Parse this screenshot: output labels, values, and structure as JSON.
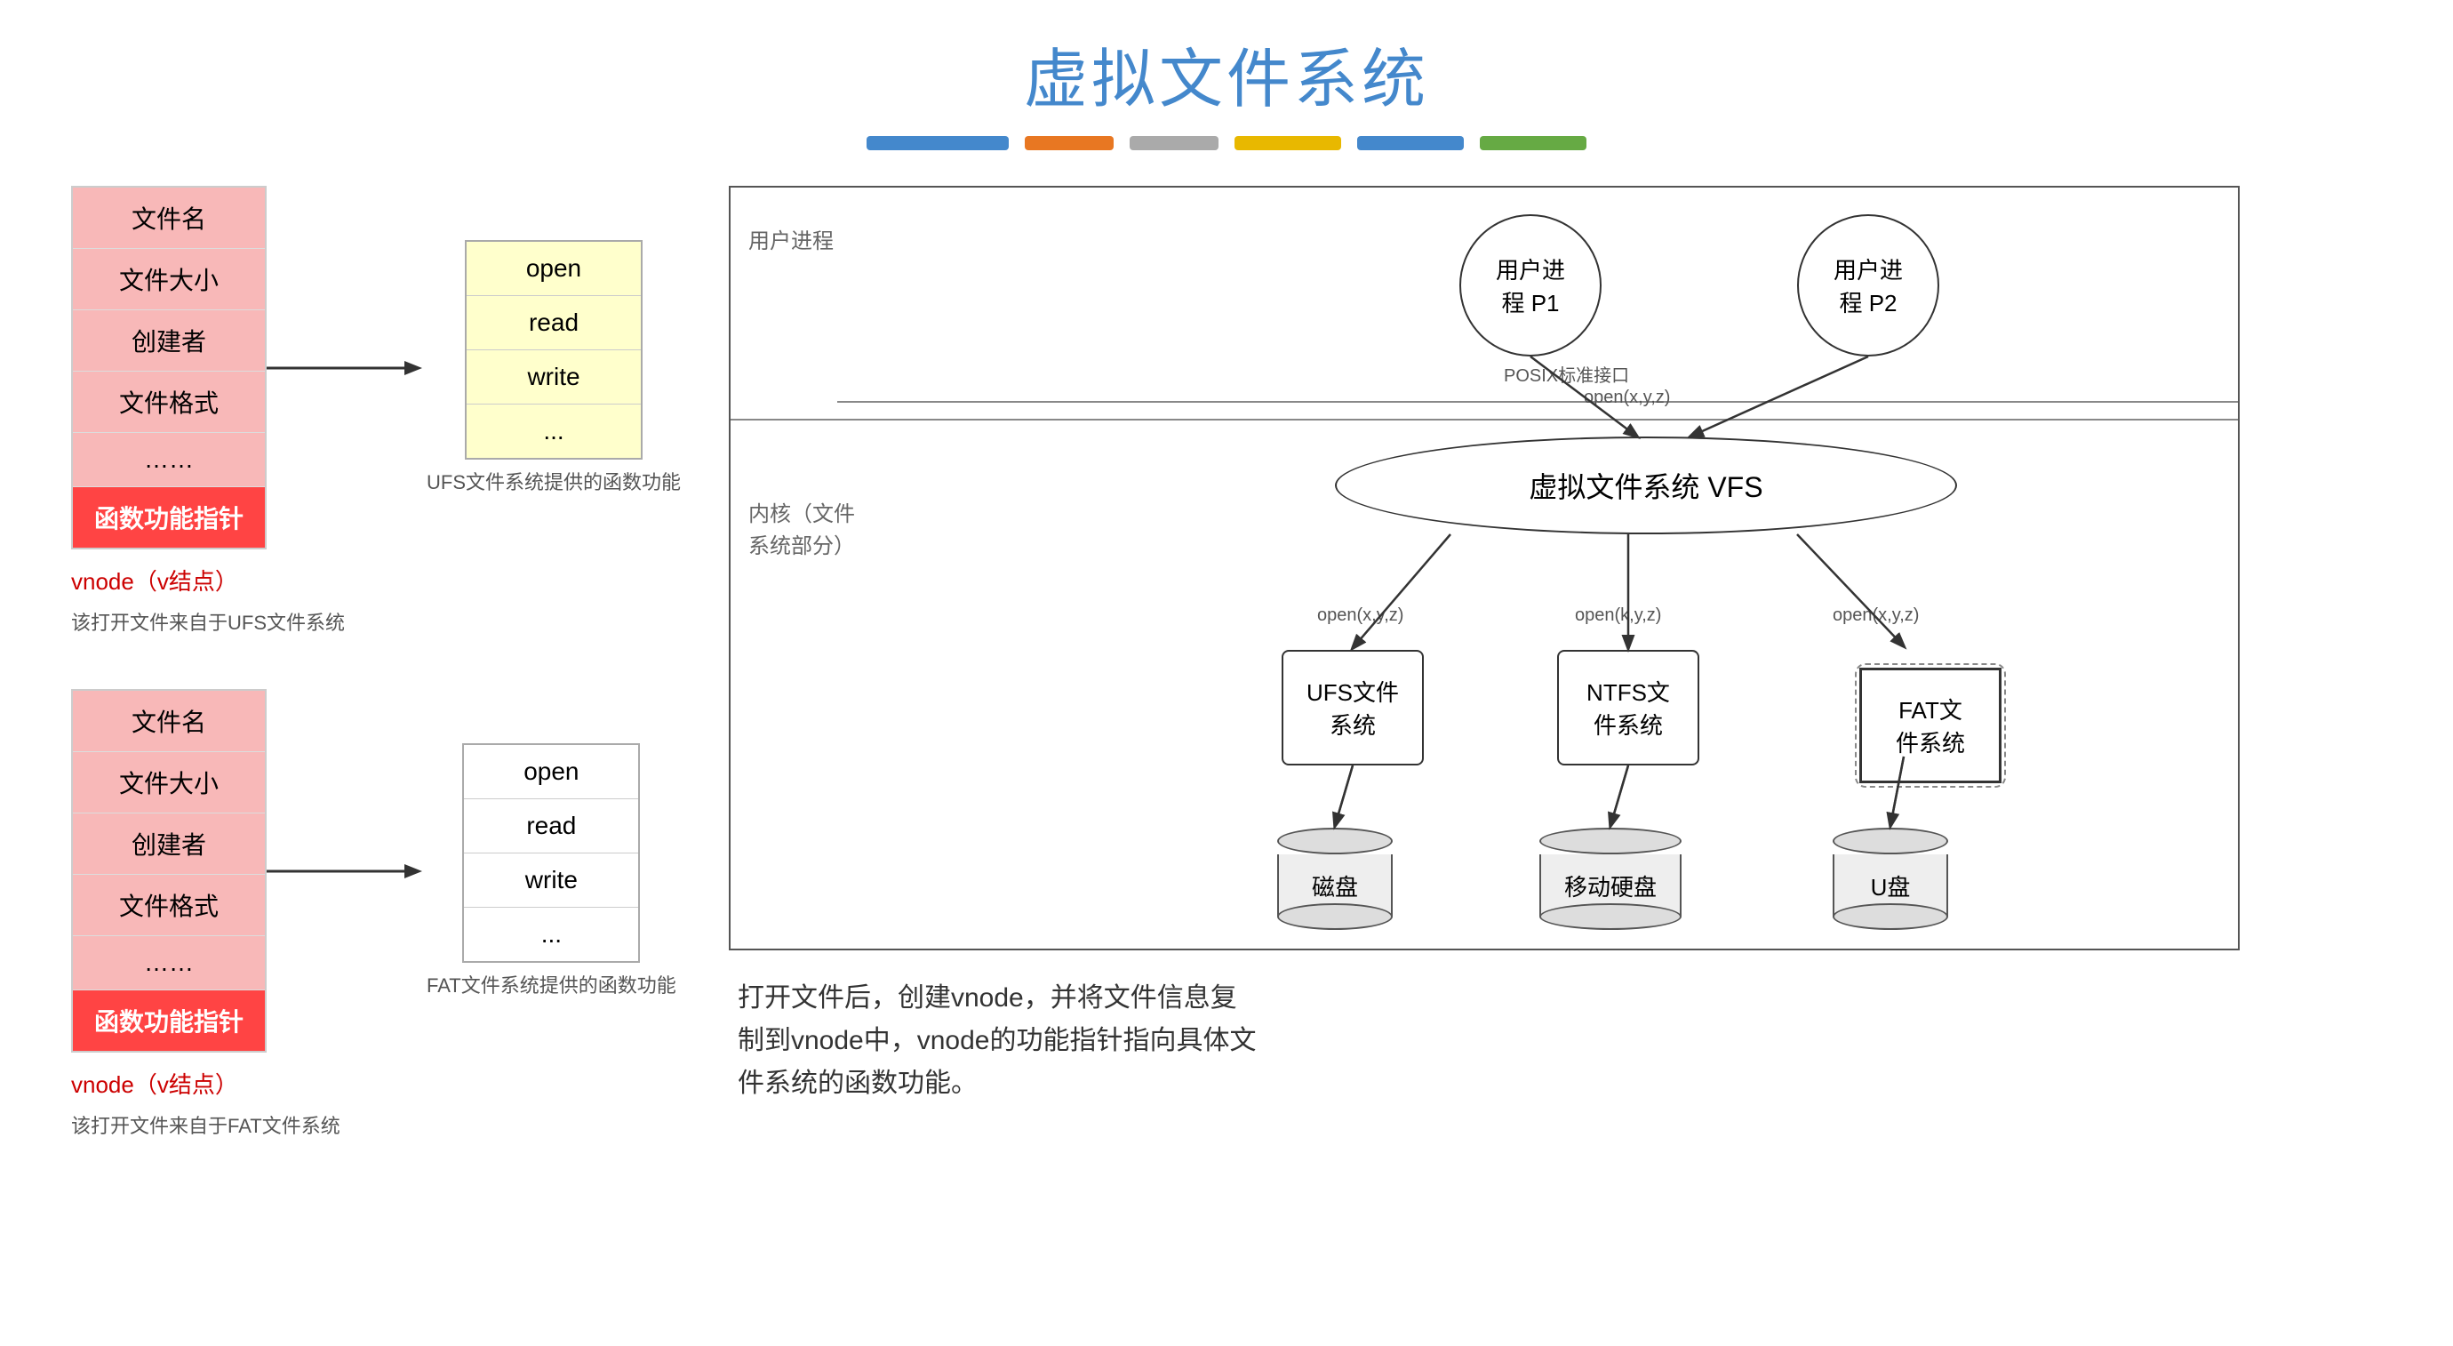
{
  "title": "虚拟文件系统",
  "colorBar": [
    {
      "color": "#4488cc",
      "width": 160
    },
    {
      "color": "#e87722",
      "width": 100
    },
    {
      "color": "#aaa",
      "width": 100
    },
    {
      "color": "#e8b800",
      "width": 120
    },
    {
      "color": "#4488cc",
      "width": 120
    },
    {
      "color": "#66aa44",
      "width": 120
    }
  ],
  "vnode1": {
    "rows": [
      "文件名",
      "文件大小",
      "创建者",
      "文件格式",
      "……",
      "函数功能指针"
    ],
    "label": "vnode（v结点）",
    "sublabel": "该打开文件来自于UFS文件系统",
    "funcRows": [
      "open",
      "read",
      "write",
      "..."
    ],
    "funcLabel": "UFS文件系统提供的函数功能"
  },
  "vnode2": {
    "rows": [
      "文件名",
      "文件大小",
      "创建者",
      "文件格式",
      "……",
      "函数功能指针"
    ],
    "label": "vnode（v结点）",
    "sublabel": "该打开文件来自于FAT文件系统",
    "funcRows": [
      "open",
      "read",
      "write",
      "..."
    ],
    "funcLabel": "FAT文件系统提供的函数功能"
  },
  "vfsDiagram": {
    "userLabel": "用户进程",
    "kernelLabel": "内核（文件\n系统部分）",
    "posixLabel": "POSIX标准接口",
    "openLabel": "open(x,y,z)",
    "proc1": "用户进\n程 P1",
    "proc2": "用户进\n程 P2",
    "vfsLabel": "虚拟文件系统 VFS",
    "ufs": "UFS文件\n系统",
    "ntfs": "NTFS文\n件系统",
    "fat": "FAT文\n件系统",
    "disk1": "磁盘",
    "disk2": "移动硬盘",
    "disk3": "U盘",
    "openLabels": [
      "open(x,y,z)",
      "open(x,y,z)",
      "open(k,y,z)",
      "open(x,y,z)"
    ]
  },
  "bottomText": "打开文件后，创建vnode，并将文件信息复\n制到vnode中，vnode的功能指针指向具体文\n件系统的函数功能。"
}
